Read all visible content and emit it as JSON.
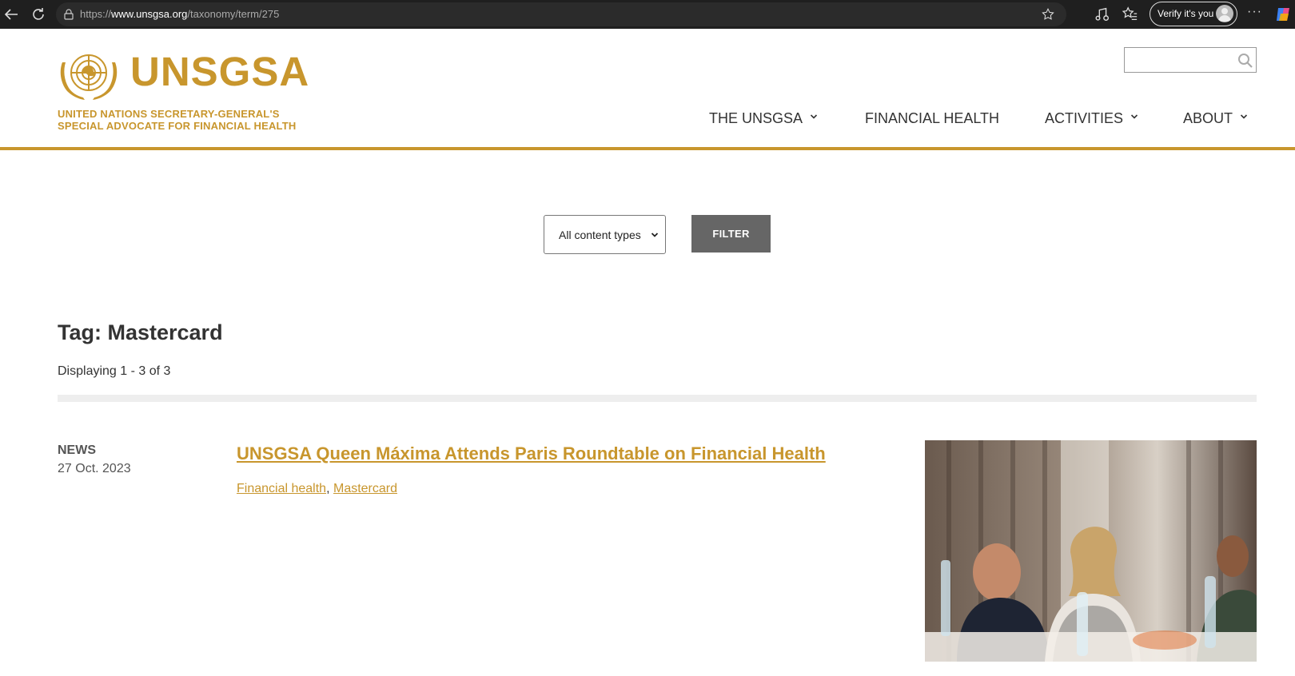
{
  "browser": {
    "url_prefix": "https://",
    "url_host": "www.unsgsa.org",
    "url_path": "/taxonomy/term/275",
    "verify_label": "Verify it's you",
    "more_label": "···"
  },
  "header": {
    "logo_word": "UNSGSA",
    "logo_line1": "UNITED NATIONS SECRETARY-GENERAL'S",
    "logo_line2": "SPECIAL ADVOCATE FOR FINANCIAL HEALTH",
    "search_placeholder": "",
    "nav": [
      {
        "label": "THE UNSGSA",
        "has_dropdown": true
      },
      {
        "label": "FINANCIAL HEALTH",
        "has_dropdown": false
      },
      {
        "label": "ACTIVITIES",
        "has_dropdown": true
      },
      {
        "label": "ABOUT",
        "has_dropdown": true
      }
    ]
  },
  "filter": {
    "selected": "All content types",
    "button_label": "FILTER"
  },
  "main": {
    "title": "Tag: Mastercard",
    "count": "Displaying 1 - 3 of 3",
    "items": [
      {
        "type": "NEWS",
        "date": "27 Oct. 2023",
        "title": "UNSGSA Queen Máxima Attends Paris Roundtable on Financial Health",
        "tags": [
          "Financial health",
          "Mastercard"
        ],
        "tag_separator": ","
      }
    ]
  },
  "colors": {
    "brand_gold": "#c8962d",
    "filter_button": "#666666",
    "chrome_bg": "#1f1f1f"
  }
}
